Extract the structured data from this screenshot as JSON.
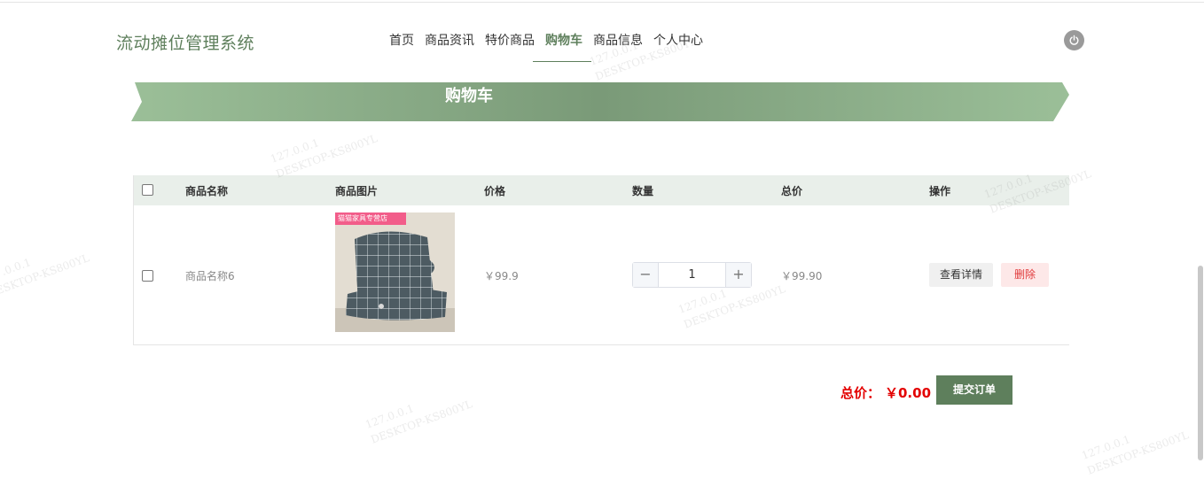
{
  "header": {
    "logo": "流动摊位管理系统",
    "nav": [
      {
        "label": "首页",
        "active": false
      },
      {
        "label": "商品资讯",
        "active": false
      },
      {
        "label": "特价商品",
        "active": false
      },
      {
        "label": "购物车",
        "active": true
      },
      {
        "label": "商品信息",
        "active": false
      },
      {
        "label": "个人中心",
        "active": false
      }
    ],
    "power_icon": "power-icon"
  },
  "banner": {
    "title": "购物车"
  },
  "table": {
    "headers": [
      "商品名称",
      "商品图片",
      "价格",
      "数量",
      "总价",
      "操作"
    ],
    "rows": [
      {
        "checked": false,
        "name": "商品名称6",
        "image_badge": "猫猫家具专营店",
        "price": "￥99.9",
        "quantity": "1",
        "total": "￥99.90",
        "detail_label": "查看详情",
        "delete_label": "删除"
      }
    ]
  },
  "stepper": {
    "minus": "−",
    "plus": "+"
  },
  "footer": {
    "total_label": "总价：",
    "total_value": "￥0.00",
    "submit_label": "提交订单"
  },
  "watermark": {
    "ip": "127.0.0.1",
    "host": "DESKTOP-KS800YL"
  },
  "colors": {
    "accent": "#5e7f5c",
    "banner_light": "#9bbf98",
    "banner_dark": "#7a9a78",
    "table_header_bg": "#e9efea",
    "danger": "#e30000"
  }
}
